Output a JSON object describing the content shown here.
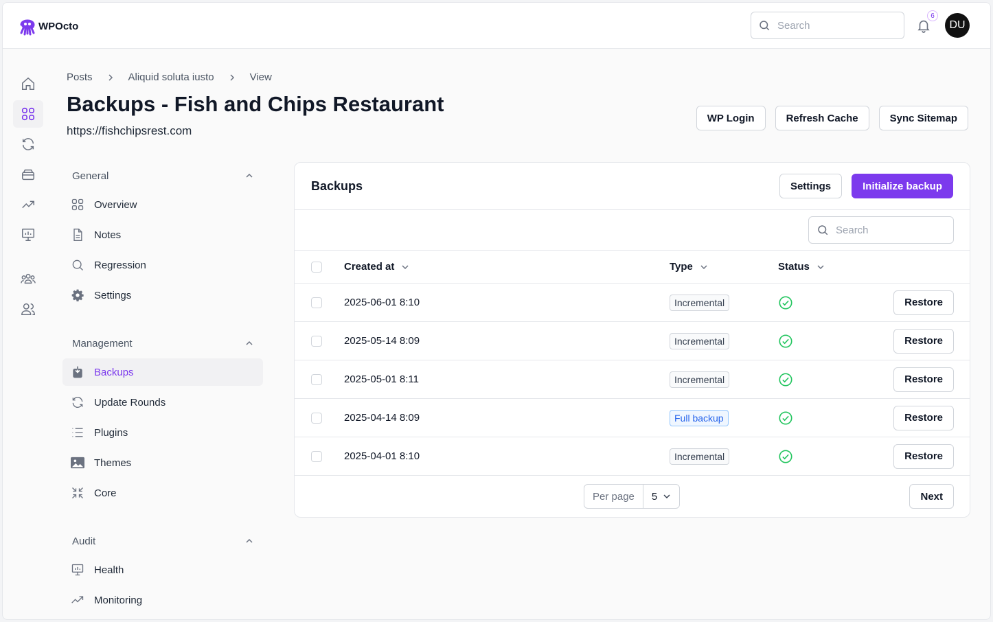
{
  "app": {
    "name": "WPOcto",
    "brand_color": "#7c3aed"
  },
  "topbar": {
    "search_placeholder": "Search",
    "notification_count": "6",
    "avatar_initials": "DU"
  },
  "breadcrumb": [
    "Posts",
    "Aliquid soluta iusto",
    "View"
  ],
  "page": {
    "title": "Backups - Fish and Chips Restaurant",
    "url": "https://fishchipsrest.com"
  },
  "header_buttons": {
    "wp_login": "WP Login",
    "refresh_cache": "Refresh Cache",
    "sync_sitemap": "Sync Sitemap"
  },
  "nav": {
    "general": {
      "label": "General",
      "items": [
        "Overview",
        "Notes",
        "Regression",
        "Settings"
      ]
    },
    "management": {
      "label": "Management",
      "items": [
        "Backups",
        "Update Rounds",
        "Plugins",
        "Themes",
        "Core"
      ],
      "active": "Backups"
    },
    "audit": {
      "label": "Audit",
      "items": [
        "Health",
        "Monitoring"
      ]
    }
  },
  "card": {
    "title": "Backups",
    "settings_label": "Settings",
    "init_label": "Initialize backup",
    "search_placeholder": "Search",
    "columns": {
      "created_at": "Created at",
      "type": "Type",
      "status": "Status"
    },
    "rows": [
      {
        "created_at": "2025-06-01 8:10",
        "type": "Incremental",
        "status": "success",
        "action": "Restore"
      },
      {
        "created_at": "2025-05-14 8:09",
        "type": "Incremental",
        "status": "success",
        "action": "Restore"
      },
      {
        "created_at": "2025-05-01 8:11",
        "type": "Incremental",
        "status": "success",
        "action": "Restore"
      },
      {
        "created_at": "2025-04-14 8:09",
        "type": "Full backup",
        "status": "success",
        "action": "Restore"
      },
      {
        "created_at": "2025-04-01 8:10",
        "type": "Incremental",
        "status": "success",
        "action": "Restore"
      }
    ],
    "per_page_label": "Per page",
    "per_page_value": "5",
    "next_label": "Next"
  }
}
